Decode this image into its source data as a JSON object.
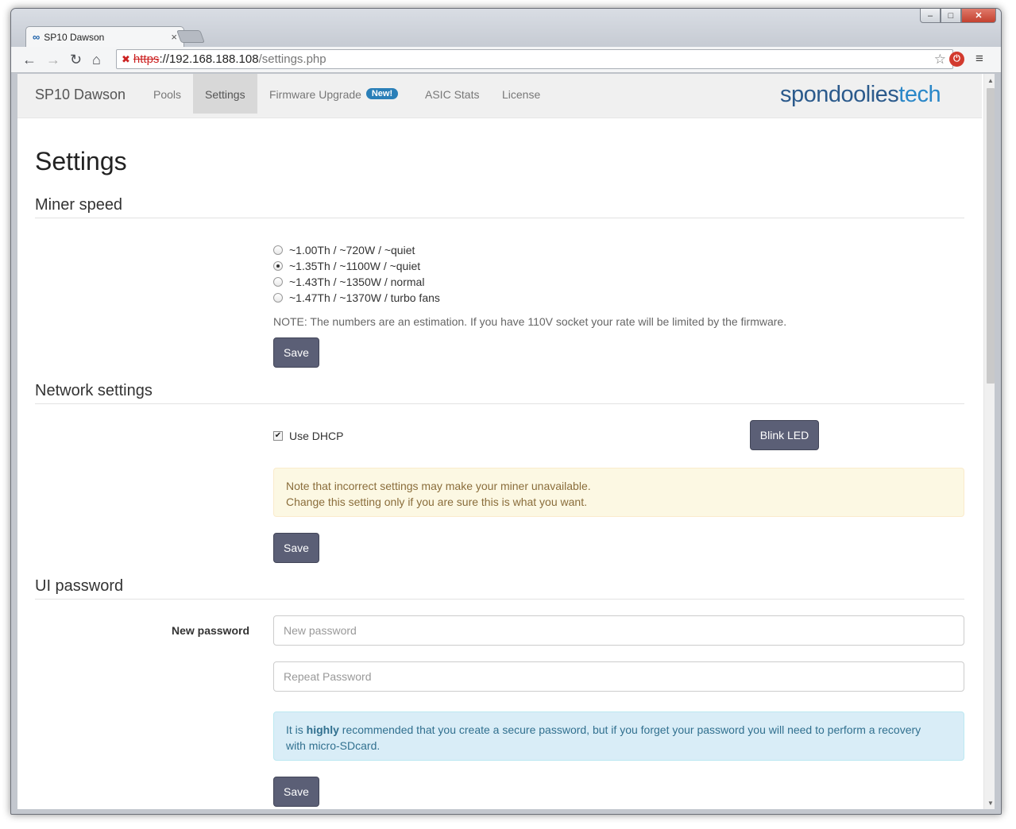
{
  "browser": {
    "tab_title": "SP10 Dawson",
    "tab_close": "×",
    "url_scheme": "https",
    "url_host": "://192.168.188.108",
    "url_path": "/settings.php",
    "win_min": "‒",
    "win_max": "□",
    "win_close": "✕"
  },
  "navbar": {
    "brand": "SP10 Dawson",
    "items": [
      {
        "label": "Pools"
      },
      {
        "label": "Settings"
      },
      {
        "label": "Firmware Upgrade",
        "badge": "New!"
      },
      {
        "label": "ASIC Stats"
      },
      {
        "label": "License"
      }
    ],
    "logo_a": "spondoolies",
    "logo_b": "tech"
  },
  "page": {
    "title": "Settings"
  },
  "miner_speed": {
    "title": "Miner speed",
    "options": [
      {
        "label": "~1.00Th / ~720W / ~quiet",
        "checked": false
      },
      {
        "label": "~1.35Th / ~1100W / ~quiet",
        "checked": true
      },
      {
        "label": "~1.43Th / ~1350W / normal",
        "checked": false
      },
      {
        "label": "~1.47Th / ~1370W / turbo fans",
        "checked": false
      }
    ],
    "note": "NOTE: The numbers are an estimation. If you have 110V socket your rate will be limited by the firmware.",
    "save_label": "Save"
  },
  "network": {
    "title": "Network settings",
    "dhcp_label": "Use DHCP",
    "dhcp_checked": true,
    "blink_label": "Blink LED",
    "warning_line1": "Note that incorrect settings may make your miner unavailable.",
    "warning_line2": "Change this setting only if you are sure this is what you want.",
    "save_label": "Save"
  },
  "password": {
    "title": "UI password",
    "new_label": "New password",
    "new_placeholder": "New password",
    "repeat_placeholder": "Repeat Password",
    "info_pre": "It is ",
    "info_bold": "highly",
    "info_post": " recommended that you create a secure password, but if you forget your password you will need to perform a recovery",
    "info_line2": "with micro-SDcard.",
    "save_label": "Save"
  },
  "colors": {
    "button": "#5b5f76",
    "badge": "#2a7fb8",
    "warning_bg": "#fcf8e3",
    "info_bg": "#d9edf7"
  }
}
